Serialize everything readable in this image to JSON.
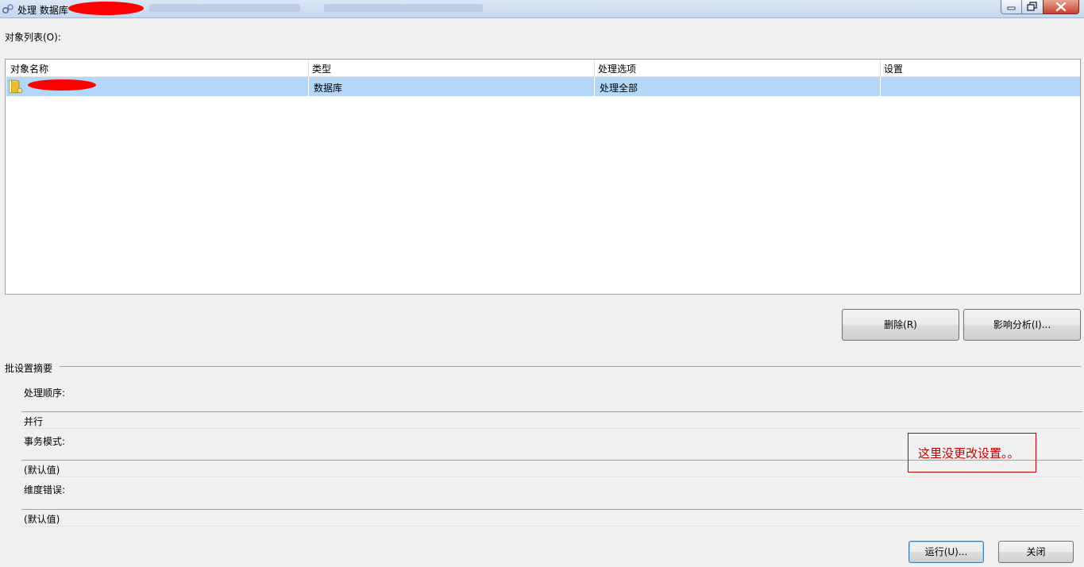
{
  "window": {
    "title": "处理 数据库",
    "title_icon": "process-gears-icon",
    "minimize_icon": "minimize-icon",
    "restore_icon": "restore-icon",
    "close_icon": "close-icon"
  },
  "object_list": {
    "label": "对象列表(O):",
    "columns": [
      "对象名称",
      "类型",
      "处理选项",
      "设置"
    ],
    "rows": [
      {
        "icon": "database-icon",
        "name": "",
        "type": "数据库",
        "process_option": "处理全部",
        "settings": ""
      }
    ]
  },
  "buttons": {
    "remove": "删除(R)",
    "impact_analysis": "影响分析(I)...",
    "run": "运行(U)...",
    "close": "关闭"
  },
  "batch_summary": {
    "heading": "批设置摘要",
    "processing_order_label": "处理顺序:",
    "processing_order_value": "并行",
    "transaction_mode_label": "事务模式:",
    "transaction_mode_value": "(默认值)",
    "dimension_errors_label": "维度错误:",
    "dimension_errors_value": "(默认值)"
  },
  "annotation": {
    "text": "这里没更改设置。。",
    "color": "#c00000"
  },
  "colors": {
    "selection": "#b3d7f6",
    "redaction": "#ff0000"
  }
}
